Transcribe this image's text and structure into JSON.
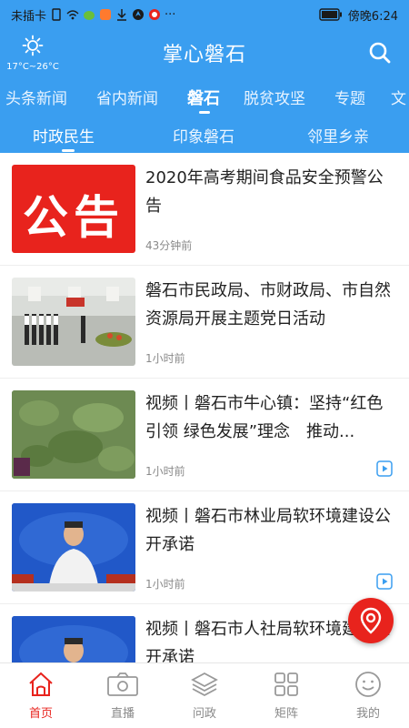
{
  "status_bar": {
    "carrier": "未插卡",
    "time": "傍晚6:24",
    "more": "···"
  },
  "header": {
    "weather_temp": "17°C~26°C",
    "title": "掌心磐石",
    "search_icon": "search-icon"
  },
  "channels": [
    {
      "label": "头条新闻"
    },
    {
      "label": "省内新闻"
    },
    {
      "label": "磐石"
    },
    {
      "label": "脱贫攻坚"
    },
    {
      "label": "专题"
    },
    {
      "label": "文"
    }
  ],
  "active_channel": "磐石",
  "subtabs": [
    {
      "label": "时政民生"
    },
    {
      "label": "印象磐石"
    },
    {
      "label": "邻里乡亲"
    }
  ],
  "active_subtab": "时政民生",
  "feed": [
    {
      "title": "2020年高考期间食品安全预警公告",
      "time": "43分钟前",
      "thumb_text": "公告",
      "video": false
    },
    {
      "title": "磐石市民政局、市财政局、市自然资源局开展主题党日活动",
      "time": "1小时前",
      "video": false
    },
    {
      "title": "视频丨磐石市牛心镇：坚持“红色引领 绿色发展”理念　推动...",
      "time": "1小时前",
      "video": true
    },
    {
      "title": "视频丨磐石市林业局软环境建设公开承诺",
      "time": "1小时前",
      "video": true
    },
    {
      "title": "视频丨磐石市人社局软环境建设公开承诺",
      "time": "",
      "video": true
    }
  ],
  "bottom_nav": [
    {
      "label": "首页",
      "icon": "home-icon"
    },
    {
      "label": "直播",
      "icon": "video-camera-icon"
    },
    {
      "label": "问政",
      "icon": "layers-icon"
    },
    {
      "label": "矩阵",
      "icon": "grid-icon"
    },
    {
      "label": "我的",
      "icon": "smiley-icon"
    }
  ],
  "colors": {
    "brand_blue": "#3a9ef0",
    "accent_red": "#e8231d"
  }
}
